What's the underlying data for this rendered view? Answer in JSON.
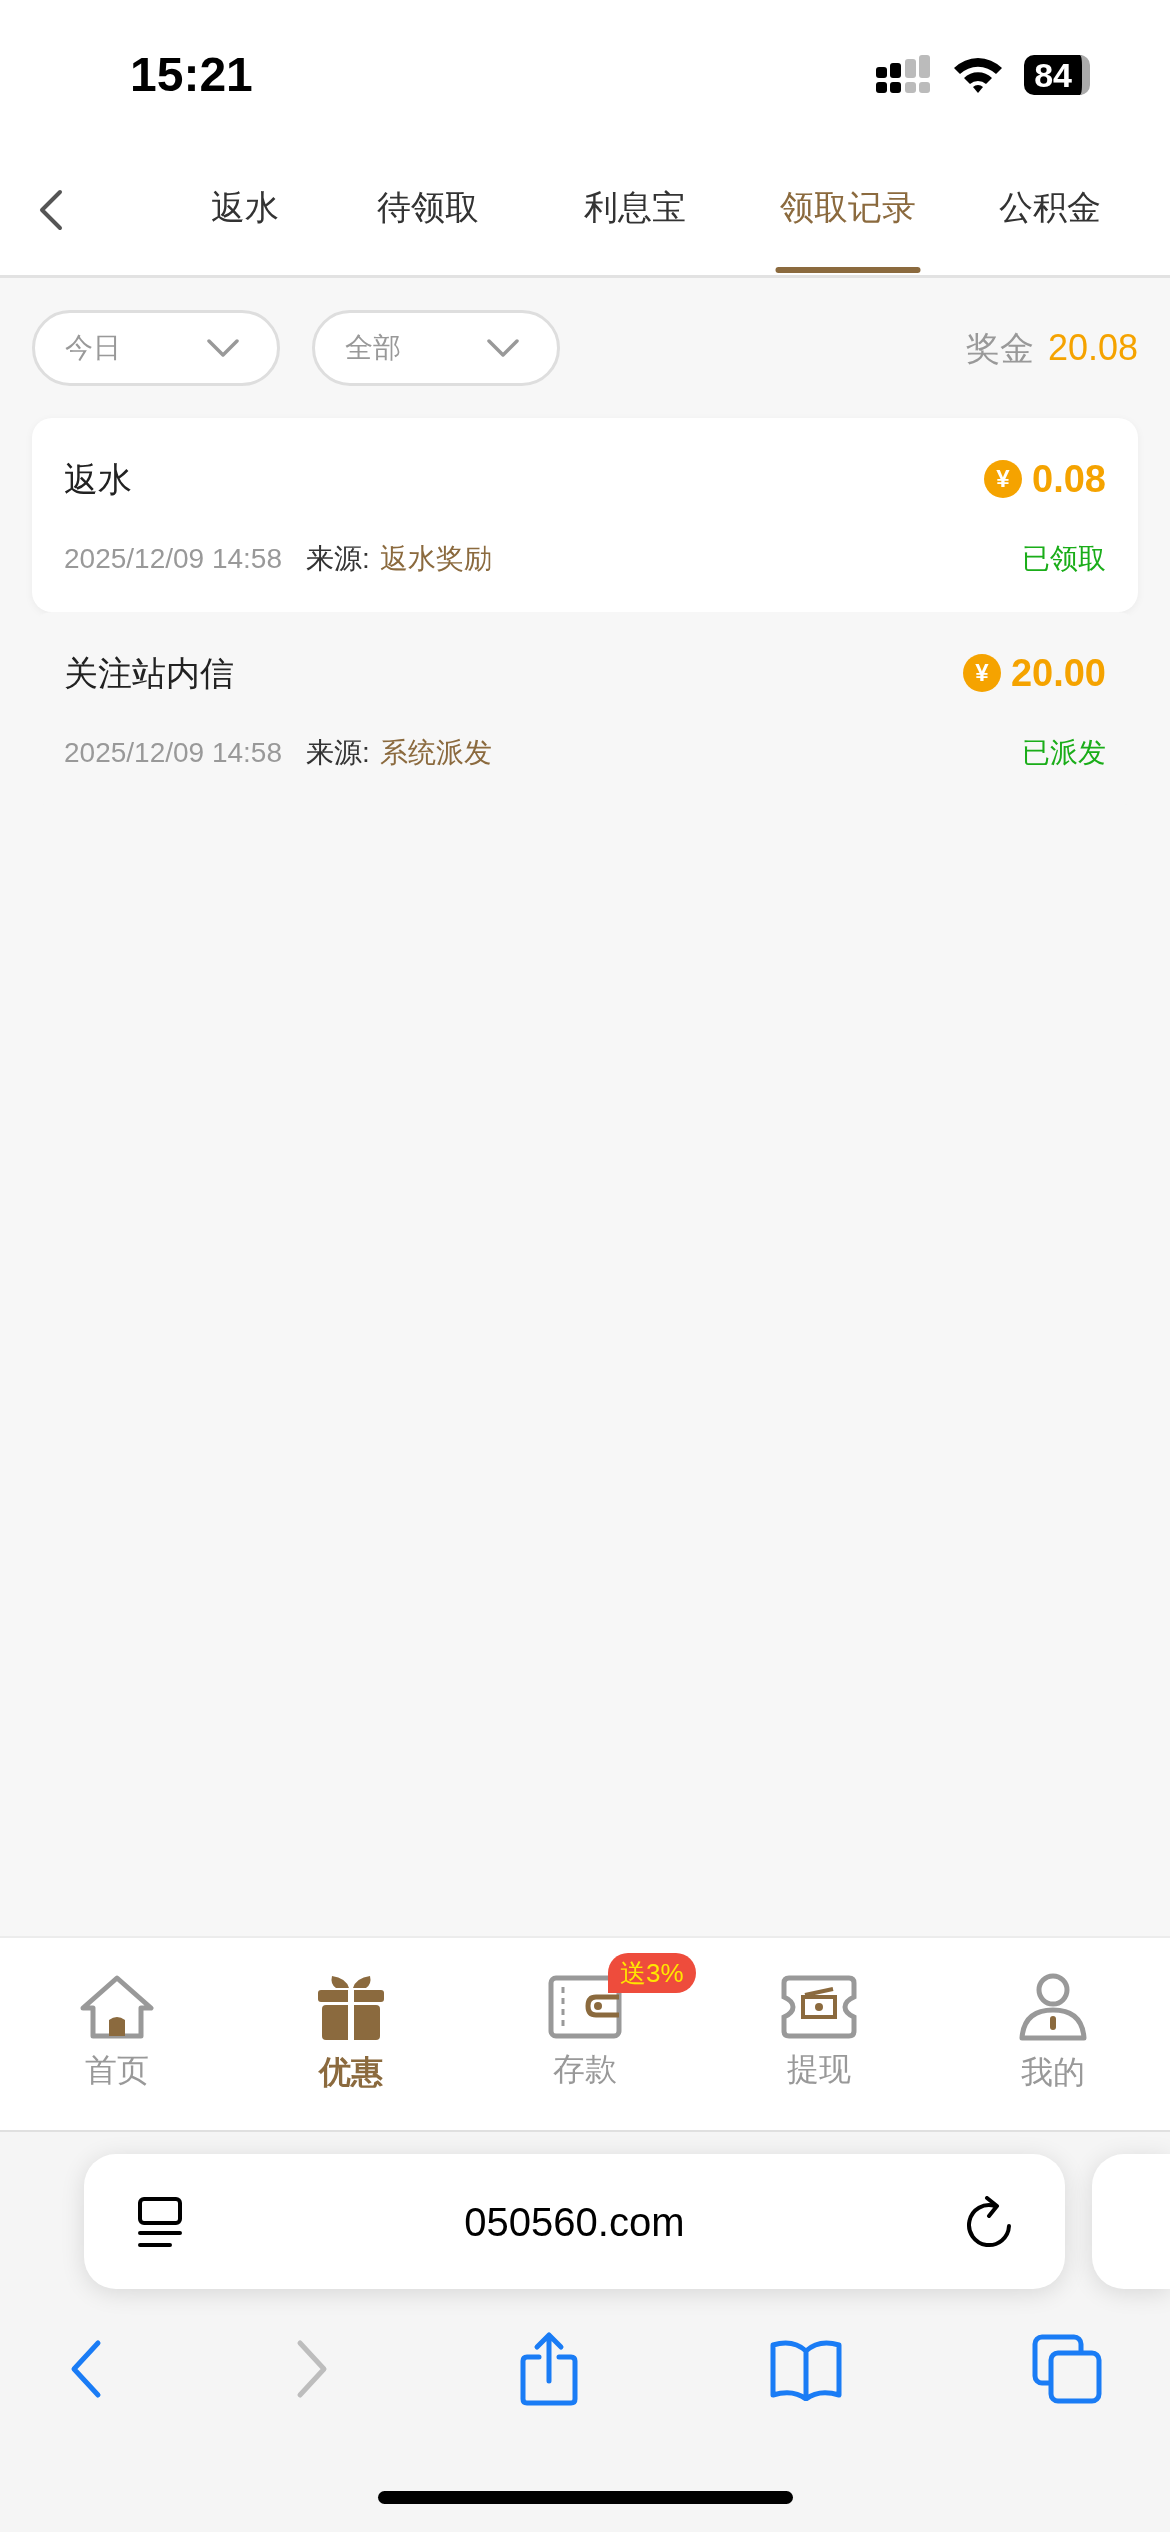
{
  "status_bar": {
    "time": "15:21",
    "battery": "84"
  },
  "tabs": [
    {
      "label": "返水",
      "selected": false
    },
    {
      "label": "待领取",
      "selected": false
    },
    {
      "label": "利息宝",
      "selected": false
    },
    {
      "label": "领取记录",
      "selected": true
    },
    {
      "label": "公积金",
      "selected": false
    }
  ],
  "filters": [
    {
      "label": "今日"
    },
    {
      "label": "全部"
    }
  ],
  "bonus": {
    "label": "奖金",
    "value": "20.08"
  },
  "records": [
    {
      "title": "返水",
      "currency_symbol": "¥",
      "amount": "0.08",
      "time": "2025/12/09 14:58",
      "source_label": "来源:",
      "source": "返水奖励",
      "status": "已领取",
      "kind": "card"
    },
    {
      "title": "关注站内信",
      "currency_symbol": "¥",
      "amount": "20.00",
      "time": "2025/12/09 14:58",
      "source_label": "来源:",
      "source": "系统派发",
      "status": "已派发",
      "kind": "plain"
    }
  ],
  "bottom_nav": [
    {
      "kind": "home",
      "label": "首页",
      "selected": false
    },
    {
      "kind": "gift",
      "label": "优惠",
      "selected": true
    },
    {
      "kind": "wallet",
      "label": "存款",
      "selected": false,
      "badge": "送3%"
    },
    {
      "kind": "ticket",
      "label": "提现",
      "selected": false
    },
    {
      "kind": "person",
      "label": "我的",
      "selected": false
    }
  ],
  "browser": {
    "url": "050560.com",
    "toolbar": [
      {
        "kind": "back",
        "disabled": false
      },
      {
        "kind": "forward",
        "disabled": true
      },
      {
        "kind": "share",
        "disabled": false
      },
      {
        "kind": "bookmarks",
        "disabled": false
      },
      {
        "kind": "tabs",
        "disabled": false
      }
    ]
  }
}
